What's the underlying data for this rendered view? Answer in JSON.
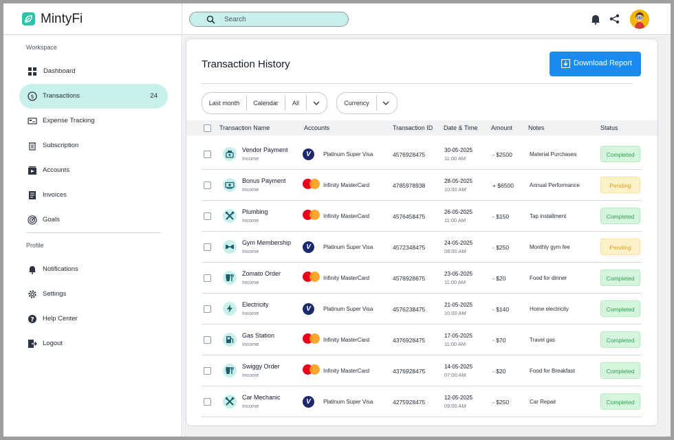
{
  "app": {
    "name": "MintyFi"
  },
  "search": {
    "placeholder": "Search"
  },
  "sidebar": {
    "workspace_label": "Workspace",
    "profile_label": "Profile",
    "workspace_items": [
      {
        "label": "Dashboard",
        "icon": "dashboard-icon"
      },
      {
        "label": "Transactions",
        "icon": "dollar-icon",
        "count": "24",
        "active": true
      },
      {
        "label": "Expense Tracking",
        "icon": "expense-icon"
      },
      {
        "label": "Subscription",
        "icon": "trash-icon"
      },
      {
        "label": "Accounts",
        "icon": "accounts-icon"
      },
      {
        "label": "Invoices",
        "icon": "invoice-icon"
      },
      {
        "label": "Goals",
        "icon": "target-icon"
      }
    ],
    "profile_items": [
      {
        "label": "Notifications",
        "icon": "bell-icon"
      },
      {
        "label": "Settings",
        "icon": "gear-icon"
      },
      {
        "label": "Help Center",
        "icon": "help-icon"
      },
      {
        "label": "Logout",
        "icon": "logout-icon"
      }
    ]
  },
  "main": {
    "title": "Transaction History",
    "download_label": "Download Report",
    "filters": {
      "period": "Last month",
      "calendar": "Calendar",
      "type": "All",
      "currency": "Currency"
    },
    "columns": [
      "Transaction Name",
      "Accounts",
      "Transaction ID",
      "Date & Time",
      "Amount",
      "Notes",
      "Status"
    ],
    "colors": {
      "accent": "#1a8cf0",
      "mint": "#c8f0ea",
      "completed": "#2f9e57",
      "pending": "#d9a21b"
    },
    "rows": [
      {
        "name": "Vendor Payment",
        "type": "Income",
        "icon": "cash-register-icon",
        "card": "visa",
        "card_name": "Platinum Super Visa",
        "id": "4576928475",
        "date": "30-05-2025",
        "time": "11:00 AM",
        "amount": "-  $2500",
        "note": "Material Purchases",
        "status": "Completed"
      },
      {
        "name": "Bonus Payment",
        "type": "Income",
        "icon": "money-icon",
        "card": "mastercard",
        "card_name": "Infinity MasterCard",
        "id": "4785978938",
        "date": "28-05-2025",
        "time": "10:00 AM",
        "amount": "+ $6500",
        "note": "Annual Performance",
        "status": "Pending"
      },
      {
        "name": "Plumbing",
        "type": "Income",
        "icon": "tools-icon",
        "card": "mastercard",
        "card_name": "Infinity MasterCard",
        "id": "4576458475",
        "date": "26-05-2025",
        "time": "11:00 AM",
        "amount": "- $150",
        "note": "Tap installment",
        "status": "Completed"
      },
      {
        "name": "Gym Membership",
        "type": "Income",
        "icon": "dumbbell-icon",
        "card": "visa",
        "card_name": "Platinum Super Visa",
        "id": "4572348475",
        "date": "24-05-2025",
        "time": "08:00 AM",
        "amount": "- $250",
        "note": "Monthly gym fee",
        "status": "Pending"
      },
      {
        "name": "Zomato Order",
        "type": "Income",
        "icon": "food-icon",
        "card": "mastercard",
        "card_name": "Infinity MasterCard",
        "id": "4576928675",
        "date": "23-05-2025",
        "time": "11:00 AM",
        "amount": "- $20",
        "note": "Food for dinner",
        "status": "Completed"
      },
      {
        "name": "Electricity",
        "type": "Income",
        "icon": "bolt-icon",
        "card": "visa",
        "card_name": "Platinum Super Visa",
        "id": "4576238475",
        "date": "21-05-2025",
        "time": "10:00 AM",
        "amount": "- $140",
        "note": "Home electricity",
        "status": "Completed"
      },
      {
        "name": "Gas Station",
        "type": "Income",
        "icon": "gas-icon",
        "card": "mastercard",
        "card_name": "Infinity MasterCard",
        "id": "4376928475",
        "date": "17-05-2025",
        "time": "11:00 AM",
        "amount": "- $70",
        "note": "Travel gas",
        "status": "Completed"
      },
      {
        "name": "Swiggy Order",
        "type": "Income",
        "icon": "food-icon",
        "card": "mastercard",
        "card_name": "Infinity MasterCard",
        "id": "4376928475",
        "date": "14-05-2025",
        "time": "07:00 AM",
        "amount": "- $20",
        "note": "Food for Breakfast",
        "status": "Completed"
      },
      {
        "name": "Car Mechanic",
        "type": "Income",
        "icon": "tools-icon",
        "card": "visa",
        "card_name": "Platinum Super Visa",
        "id": "4275928475",
        "date": "12-05-2025",
        "time": "09:00 AM",
        "amount": "- $250",
        "note": "Car Repair",
        "status": "Completed"
      }
    ]
  }
}
